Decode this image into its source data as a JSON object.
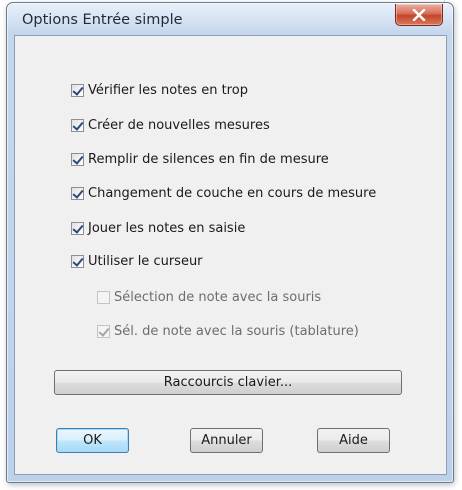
{
  "dialog": {
    "title": "Options Entrée simple",
    "close_label": "X"
  },
  "options": [
    {
      "label": "Vérifier les notes en trop",
      "checked": true,
      "enabled": true
    },
    {
      "label": "Créer de nouvelles mesures",
      "checked": true,
      "enabled": true
    },
    {
      "label": "Remplir de silences en fin de mesure",
      "checked": true,
      "enabled": true
    },
    {
      "label": "Changement de couche en cours de mesure",
      "checked": true,
      "enabled": true
    },
    {
      "label": "Jouer les notes en saisie",
      "checked": true,
      "enabled": true
    },
    {
      "label": "Utiliser le curseur",
      "checked": true,
      "enabled": true
    },
    {
      "label": "Sélection de note avec la souris",
      "checked": false,
      "enabled": false
    },
    {
      "label": "Sél. de note avec la souris (tablature)",
      "checked": true,
      "enabled": false
    }
  ],
  "buttons": {
    "shortcuts": "Raccourcis clavier...",
    "ok": "OK",
    "cancel": "Annuler",
    "help": "Aide"
  }
}
